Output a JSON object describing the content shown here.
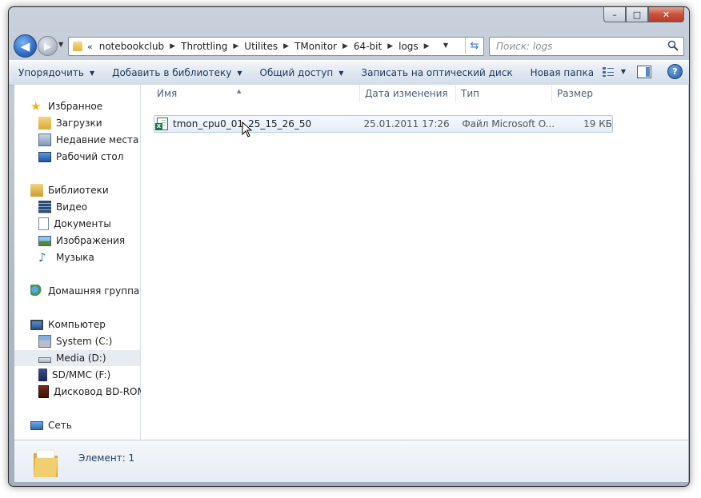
{
  "window": {
    "caption_buttons": {
      "minimize": "–",
      "maximize": "□",
      "close": "✕"
    }
  },
  "nav": {
    "back_glyph": "◀",
    "forward_glyph": "▶",
    "overflow": "«",
    "breadcrumbs": [
      "notebookclub",
      "Throttling",
      "Utilites",
      "TMonitor",
      "64-bit",
      "logs"
    ],
    "search_placeholder": "Поиск: logs"
  },
  "toolbar": {
    "items": [
      {
        "label": "Упорядочить",
        "dropdown": true
      },
      {
        "label": "Добавить в библиотеку",
        "dropdown": true
      },
      {
        "label": "Общий доступ",
        "dropdown": true
      },
      {
        "label": "Записать на оптический диск",
        "dropdown": false
      },
      {
        "label": "Новая папка",
        "dropdown": false
      }
    ],
    "help_glyph": "?"
  },
  "sidebar": {
    "groups": [
      {
        "label": "Избранное",
        "icon": "star-icon",
        "items": [
          {
            "label": "Загрузки",
            "icon": "downloads-icon"
          },
          {
            "label": "Недавние места",
            "icon": "recent-places-icon"
          },
          {
            "label": "Рабочий стол",
            "icon": "desktop-icon"
          }
        ]
      },
      {
        "label": "Библиотеки",
        "icon": "libraries-icon",
        "items": [
          {
            "label": "Видео",
            "icon": "video-icon"
          },
          {
            "label": "Документы",
            "icon": "documents-icon"
          },
          {
            "label": "Изображения",
            "icon": "pictures-icon"
          },
          {
            "label": "Музыка",
            "icon": "music-icon"
          }
        ]
      },
      {
        "label": "Домашняя группа",
        "icon": "homegroup-icon",
        "items": []
      },
      {
        "label": "Компьютер",
        "icon": "computer-icon",
        "items": [
          {
            "label": "System (C:)",
            "icon": "drive-c-icon"
          },
          {
            "label": "Media (D:)",
            "icon": "drive-d-icon",
            "selected": true
          },
          {
            "label": "SD/MMC (F:)",
            "icon": "sd-card-icon"
          },
          {
            "label": "Дисковод BD-ROM",
            "icon": "bd-rom-icon"
          }
        ]
      },
      {
        "label": "Сеть",
        "icon": "network-icon",
        "items": []
      }
    ]
  },
  "filelist": {
    "columns": [
      "Имя",
      "Дата изменения",
      "Тип",
      "Размер"
    ],
    "sort_glyph": "▲",
    "rows": [
      {
        "name": "tmon_cpu0_01_25_15_26_50",
        "date": "25.01.2011 17:26",
        "type": "Файл Microsoft O...",
        "size": "19 КБ",
        "icon": "excel-file-icon"
      }
    ]
  },
  "details": {
    "text": "Элемент: 1"
  },
  "colors": {
    "accent": "#3d77c1",
    "selection": "#e5eef9",
    "toolbar_text": "#1e395b"
  }
}
